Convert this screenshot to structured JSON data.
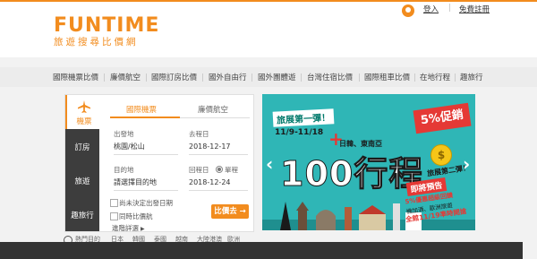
{
  "brand": {
    "logo_main": "FUNTIME",
    "logo_sub": "旅遊搜尋比價網",
    "accent": "#f28c1e"
  },
  "header": {
    "login_label": "登入",
    "separator": "|",
    "register_label": "免費註冊",
    "user_icon": "user-avatar-icon"
  },
  "nav": {
    "items": [
      {
        "label": "國際機票比價"
      },
      {
        "label": "廉價航空"
      },
      {
        "label": "國際訂房比價"
      },
      {
        "label": "國外自由行"
      },
      {
        "label": "國外團體遊"
      },
      {
        "label": "台灣住宿比價"
      },
      {
        "label": "國際租車比價"
      },
      {
        "label": "在地行程"
      },
      {
        "label": "趣旅行"
      }
    ]
  },
  "sidebar": {
    "active": {
      "label": "機票",
      "icon": "airplane-icon"
    },
    "items": [
      {
        "label": "訂房"
      },
      {
        "label": "旅遊"
      },
      {
        "label": "趣旅行"
      }
    ]
  },
  "search": {
    "tabs": [
      {
        "label": "國際機票",
        "active": true
      },
      {
        "label": "廉價航空",
        "active": false
      }
    ],
    "origin_label": "出發地",
    "origin_value": "桃園/松山",
    "depart_label": "去程日",
    "depart_value": "2018-12-17",
    "dest_label": "目的地",
    "dest_placeholder": "請選擇目的地",
    "return_label": "回程日",
    "roundtrip_label": "單程",
    "return_value": "2018-12-24",
    "undecided_label": "尚未決定出發日期",
    "compare_label": "同時比價航",
    "advanced_label": "進階詳選",
    "submit_label": "比價去"
  },
  "banner": {
    "title": "旅展第一彈！",
    "date_range": "11/9-11/18",
    "plus": "+",
    "subtitle": "日韓、東南亞",
    "main": "100行程",
    "badge": "5%促銷",
    "second": "旅展第二彈！",
    "promo1": "即將預告",
    "promo2": "5%優惠超級回饋",
    "promo3": "機加酒、歐洲旅遊",
    "promo4": "全館11/19準時開搶",
    "prev_icon": "chevron-left-icon",
    "next_icon": "chevron-right-icon",
    "colors": {
      "bg": "#2fb6b6",
      "red": "#e53935"
    }
  },
  "bottom": {
    "items": [
      "熱門目的",
      "日本",
      "韓國",
      "泰國",
      "越南",
      "大陸港澳",
      "歐洲"
    ]
  }
}
